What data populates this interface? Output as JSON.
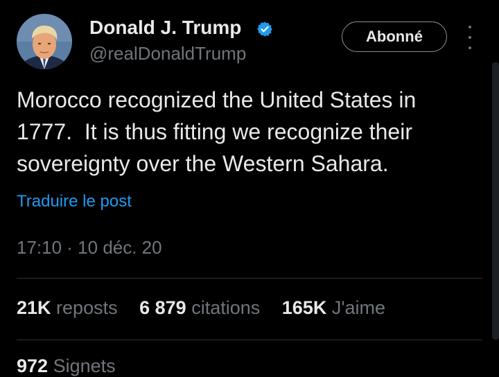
{
  "author": {
    "name": "Donald J. Trump",
    "handle": "@realDonaldTrump",
    "verified": true,
    "verified_color": "#1d9bf0"
  },
  "follow_button": {
    "label": "Abonné"
  },
  "tweet": {
    "lines": [
      "Morocco recognized the United States in",
      "1777.  It is thus fitting we recognize their",
      "sovereignty over the Western Sahara."
    ],
    "translate_label": "Traduire le post",
    "timestamp": "17:10 · 10 déc. 20"
  },
  "stats": {
    "reposts": {
      "count": "21K",
      "label": "reposts"
    },
    "quotes": {
      "count": "6 879",
      "label": "citations"
    },
    "likes": {
      "count": "165K",
      "label": "J'aime"
    },
    "bookmarks": {
      "count": "972",
      "label": "Signets"
    }
  },
  "colors": {
    "background": "#000000",
    "text": "#e7e9ea",
    "muted": "#71767b",
    "link": "#1d9bf0",
    "divider": "#2f3336"
  },
  "icons": [
    "avatar",
    "verified-badge-icon",
    "more-options-icon"
  ]
}
